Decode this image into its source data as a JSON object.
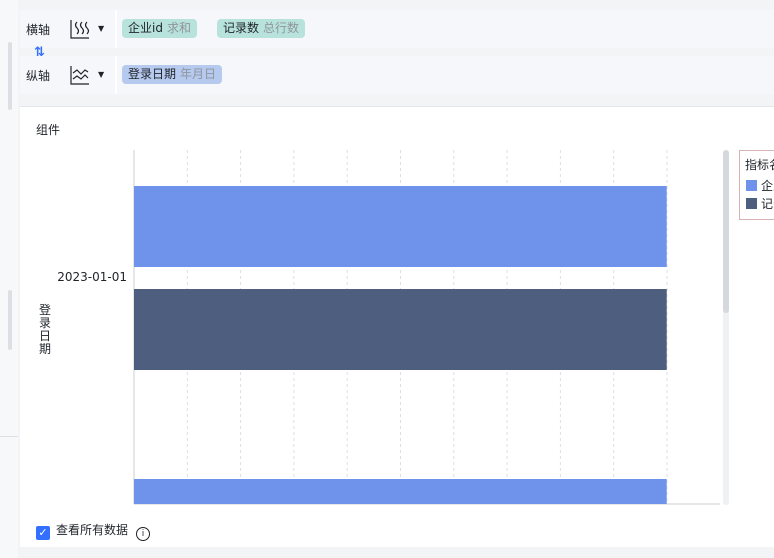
{
  "config": {
    "x_axis": {
      "label": "横轴",
      "fields": [
        {
          "name": "企业id",
          "agg": "求和"
        },
        {
          "name": "记录数",
          "agg": "总行数"
        }
      ]
    },
    "y_axis": {
      "label": "纵轴",
      "fields": [
        {
          "name": "登录日期",
          "agg": "年月日"
        }
      ]
    },
    "swap_icon": "swap-arrows-icon"
  },
  "panel": {
    "title": "组件",
    "show_all_label": "查看所有数据"
  },
  "legend": {
    "title": "指标名",
    "items": [
      "企业id",
      "记录数"
    ]
  },
  "colors": {
    "series1": "#6f93eb",
    "series2": "#4d5e7f",
    "accent": "#3370ff",
    "teal_pill": "#b8e2dc",
    "blue_pill": "#b6c9ee"
  },
  "chart_data": {
    "type": "bar",
    "orientation": "horizontal",
    "categories": [
      "2023-01-01"
    ],
    "ylabel": "登录日期",
    "xlabel": "",
    "grid": true,
    "legend_position": "right",
    "series": [
      {
        "name": "企业id",
        "values": [
          100
        ]
      },
      {
        "name": "记录数",
        "values": [
          100
        ]
      }
    ],
    "xlim": [
      0,
      110
    ],
    "note_partial": "A third bar (企业id, next date) is cut off at the bottom edge"
  }
}
